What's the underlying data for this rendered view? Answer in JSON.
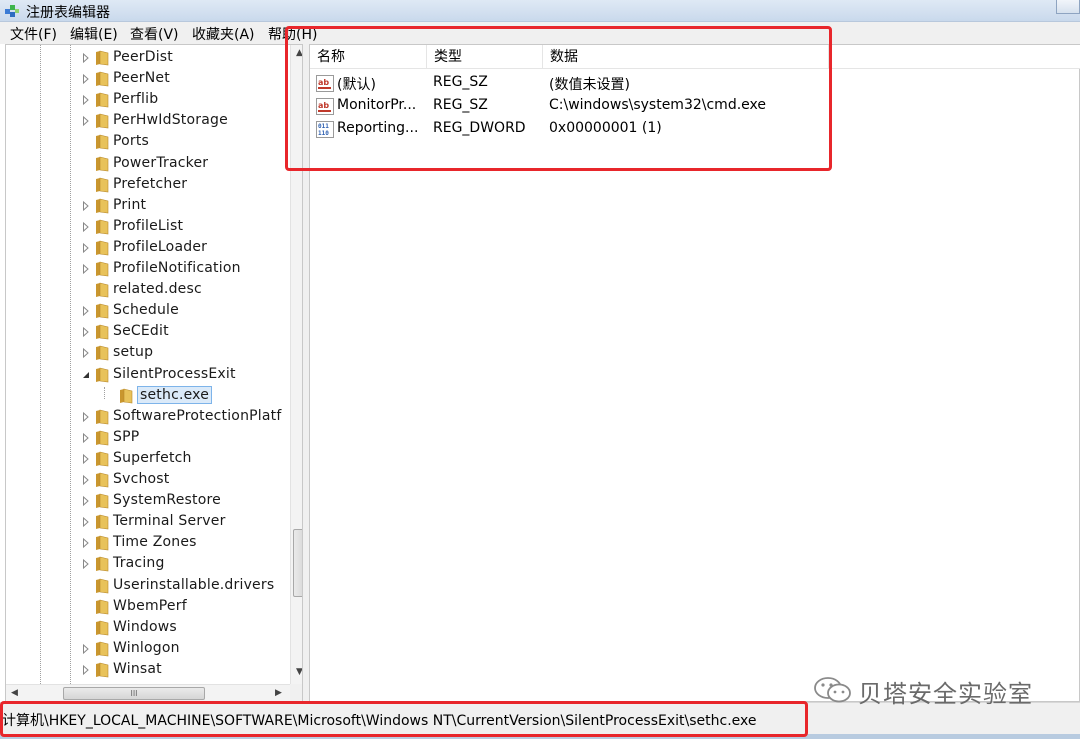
{
  "window": {
    "title": "注册表编辑器"
  },
  "menubar": {
    "items": [
      "文件(F)",
      "编辑(E)",
      "查看(V)",
      "收藏夹(A)",
      "帮助(H)"
    ]
  },
  "tree": {
    "items": [
      {
        "label": "PeerDist",
        "expandable": true
      },
      {
        "label": "PeerNet",
        "expandable": true
      },
      {
        "label": "Perflib",
        "expandable": true
      },
      {
        "label": "PerHwIdStorage",
        "expandable": true
      },
      {
        "label": "Ports",
        "expandable": false
      },
      {
        "label": "PowerTracker",
        "expandable": false
      },
      {
        "label": "Prefetcher",
        "expandable": false
      },
      {
        "label": "Print",
        "expandable": true
      },
      {
        "label": "ProfileList",
        "expandable": true
      },
      {
        "label": "ProfileLoader",
        "expandable": true
      },
      {
        "label": "ProfileNotification",
        "expandable": true
      },
      {
        "label": "related.desc",
        "expandable": false
      },
      {
        "label": "Schedule",
        "expandable": true
      },
      {
        "label": "SeCEdit",
        "expandable": true
      },
      {
        "label": "setup",
        "expandable": true
      },
      {
        "label": "SilentProcessExit",
        "expandable": true,
        "expanded": true
      },
      {
        "label": "sethc.exe",
        "expandable": false,
        "child": true,
        "selected": true
      },
      {
        "label": "SoftwareProtectionPlatf",
        "expandable": true
      },
      {
        "label": "SPP",
        "expandable": true
      },
      {
        "label": "Superfetch",
        "expandable": true
      },
      {
        "label": "Svchost",
        "expandable": true
      },
      {
        "label": "SystemRestore",
        "expandable": true
      },
      {
        "label": "Terminal Server",
        "expandable": true
      },
      {
        "label": "Time Zones",
        "expandable": true
      },
      {
        "label": "Tracing",
        "expandable": true
      },
      {
        "label": "Userinstallable.drivers",
        "expandable": false
      },
      {
        "label": "WbemPerf",
        "expandable": false
      },
      {
        "label": "Windows",
        "expandable": false
      },
      {
        "label": "Winlogon",
        "expandable": true
      },
      {
        "label": "Winsat",
        "expandable": true
      }
    ],
    "hscroll_thumb_glyph": "III"
  },
  "list": {
    "headers": {
      "name": "名称",
      "type": "类型",
      "data": "数据"
    },
    "rows": [
      {
        "name": "(默认)",
        "type": "REG_SZ",
        "data": "(数值未设置)",
        "icon": "string-value-icon"
      },
      {
        "name": "MonitorPr...",
        "type": "REG_SZ",
        "data": "C:\\windows\\system32\\cmd.exe",
        "icon": "string-value-icon"
      },
      {
        "name": "Reporting...",
        "type": "REG_DWORD",
        "data": "0x00000001 (1)",
        "icon": "dword-value-icon"
      }
    ]
  },
  "statusbar": {
    "path": "计算机\\HKEY_LOCAL_MACHINE\\SOFTWARE\\Microsoft\\Windows NT\\CurrentVersion\\SilentProcessExit\\sethc.exe"
  },
  "watermark": {
    "text": "贝塔安全实验室"
  },
  "colors": {
    "annotation": "#e8262b",
    "folder": "#e8c25a",
    "selection": "#dbeaf9"
  }
}
